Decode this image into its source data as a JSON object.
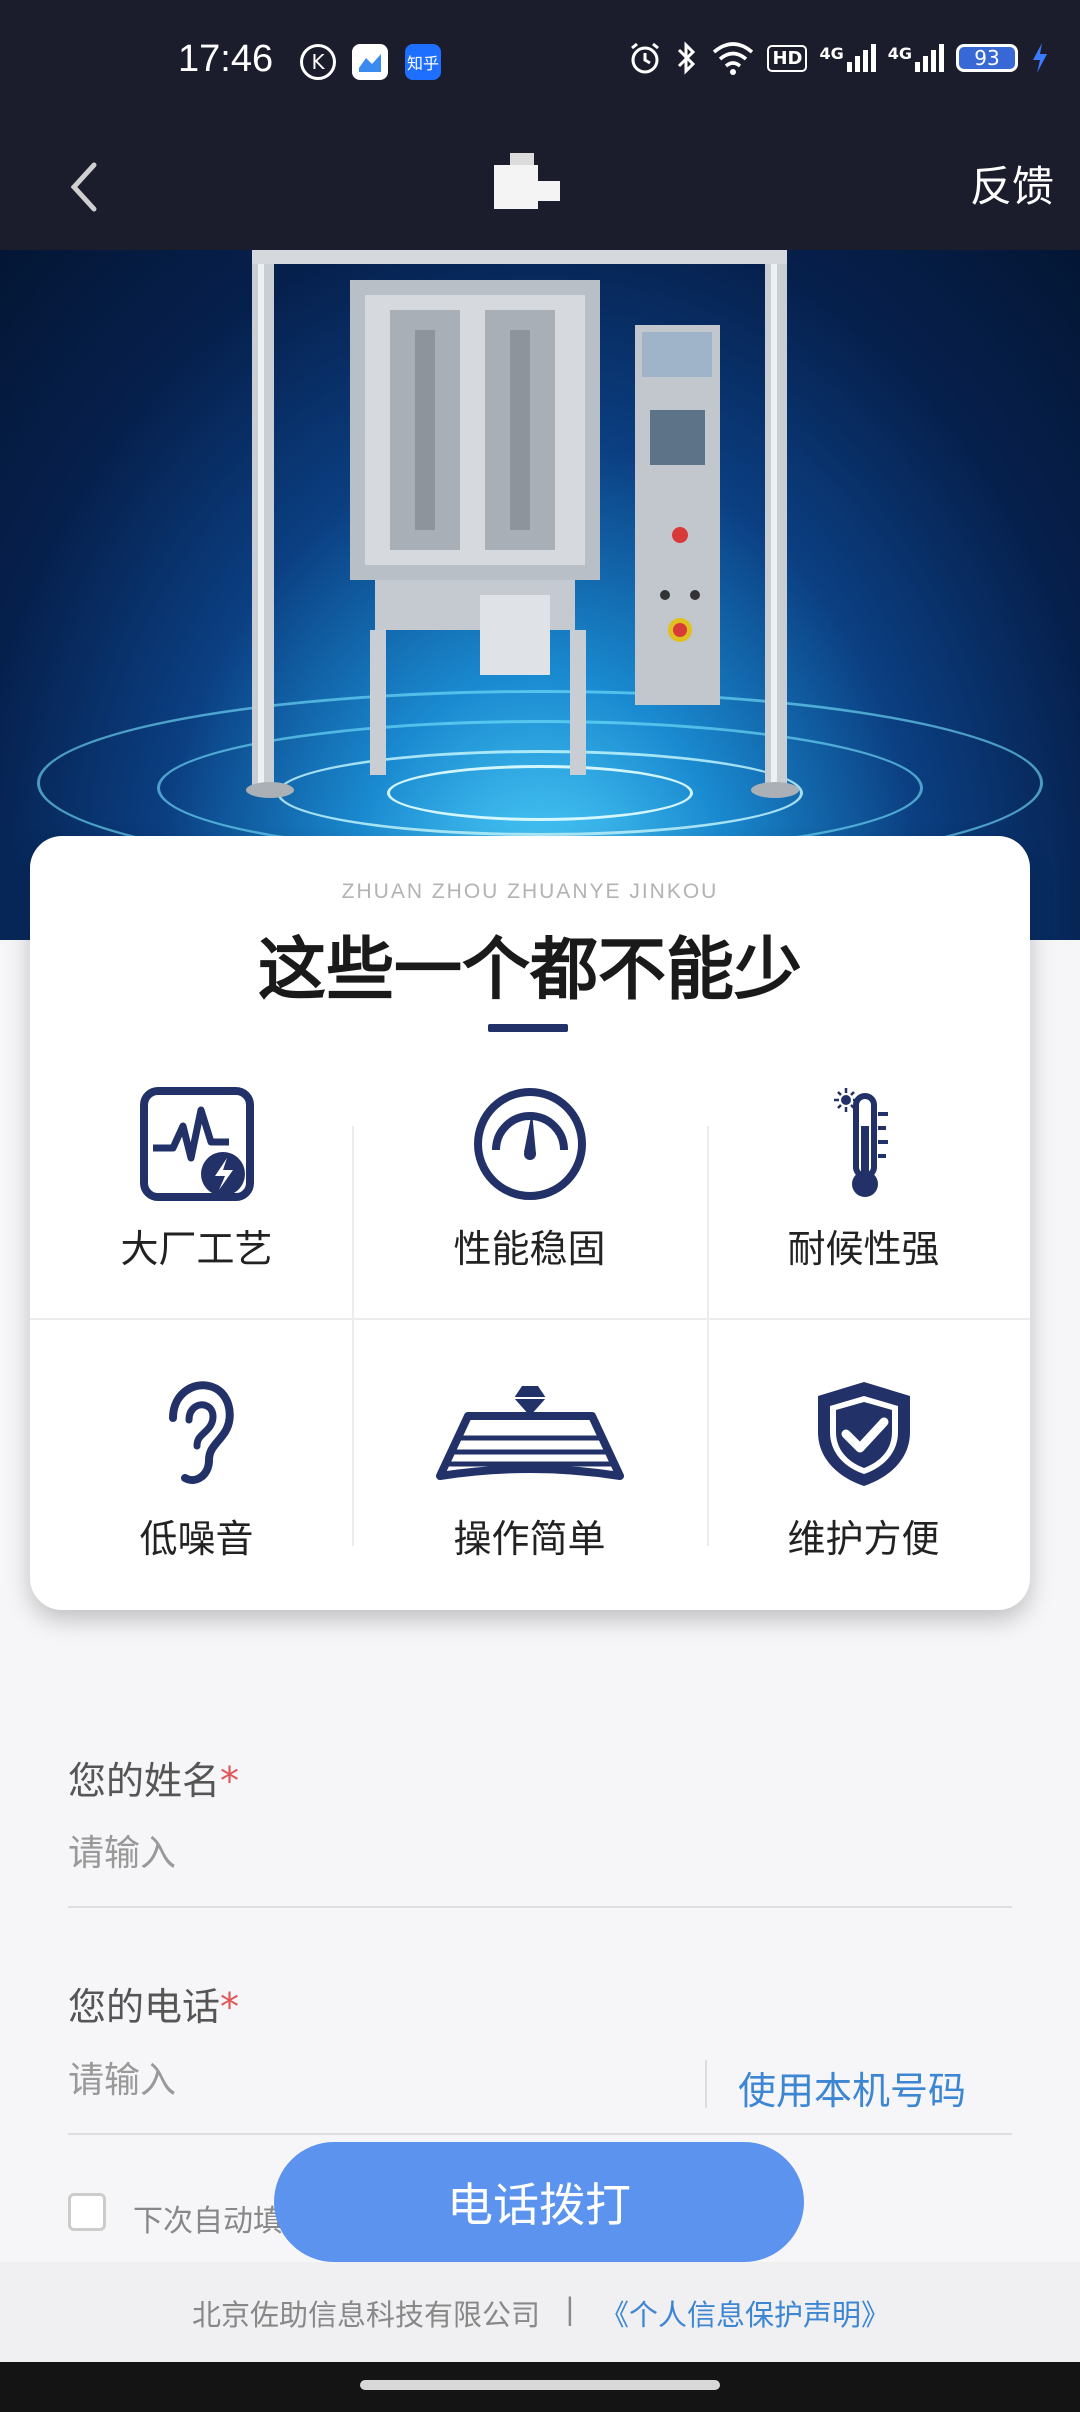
{
  "status_bar": {
    "time": "17:46",
    "apps": [
      {
        "icon": "k-app-icon",
        "label": "K"
      },
      {
        "icon": "map-app-icon",
        "label": ""
      },
      {
        "icon": "zhihu-app-icon",
        "label": "知乎"
      }
    ],
    "icons": [
      "alarm-icon",
      "bluetooth-icon",
      "wifi-icon",
      "hd-icon",
      "signal-4g-icon",
      "signal-4g-icon"
    ],
    "hd": "HD",
    "network1": "4G",
    "network2": "4G",
    "battery": "93"
  },
  "nav": {
    "back_icon": "chevron-left-icon",
    "feedback": "反馈"
  },
  "hero": {
    "image": "packaging-machine-photo"
  },
  "features": {
    "subtitle": "ZHUAN ZHOU ZHUANYE JINKOU",
    "title": "这些一个都不能少",
    "items": [
      {
        "label": "大厂工艺",
        "icon": "chart-lightning-icon"
      },
      {
        "label": "性能稳固",
        "icon": "gauge-icon"
      },
      {
        "label": "耐候性强",
        "icon": "thermometer-icon"
      },
      {
        "label": "低噪音",
        "icon": "ear-icon"
      },
      {
        "label": "操作简单",
        "icon": "diamond-platform-icon"
      },
      {
        "label": "维护方便",
        "icon": "shield-check-icon"
      }
    ]
  },
  "form": {
    "name_label": "您的姓名",
    "name_placeholder": "请输入",
    "phone_label": "您的电话",
    "phone_placeholder": "请输入",
    "required_mark": "*",
    "use_local_number": "使用本机号码",
    "auto_fill_label": "下次自动填",
    "call_button": "电话拨打"
  },
  "footer": {
    "company": "北京佐助信息科技有限公司",
    "separator": "|",
    "privacy": "《个人信息保护声明》"
  },
  "colors": {
    "header_bg": "#1c1d2c",
    "icon_navy": "#223168",
    "accent_blue": "#3d86d4",
    "button_blue": "#5b93ee",
    "required_red": "#e05555"
  }
}
